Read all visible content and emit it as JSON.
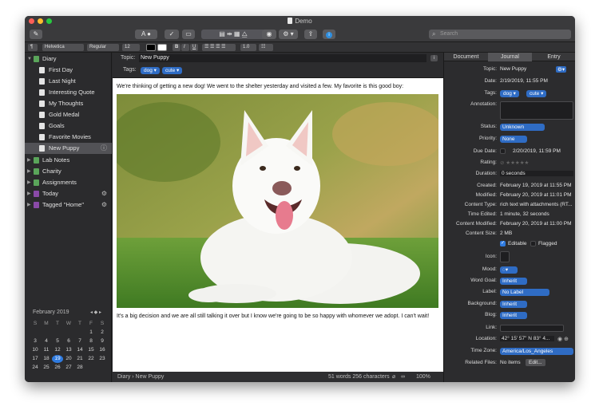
{
  "window": {
    "title": "Demo"
  },
  "toolbar": {
    "search_placeholder": "Search"
  },
  "format": {
    "font": "Helvetica",
    "style": "Regular",
    "size": "12",
    "spacing": "1.0",
    "bold": "B",
    "italic": "I",
    "underline": "U"
  },
  "sidebar": {
    "items": [
      {
        "label": "Diary",
        "color": "#5aa55a"
      },
      {
        "label": "First Day"
      },
      {
        "label": "Last Night"
      },
      {
        "label": "Interesting Quote"
      },
      {
        "label": "My Thoughts"
      },
      {
        "label": "Gold Medal"
      },
      {
        "label": "Goals"
      },
      {
        "label": "Favorite Movies"
      },
      {
        "label": "New Puppy"
      },
      {
        "label": "Lab Notes",
        "color": "#5aa55a"
      },
      {
        "label": "Charity",
        "color": "#5aa55a"
      },
      {
        "label": "Assignments",
        "color": "#5aa55a"
      },
      {
        "label": "Today",
        "color": "#8a4aa8"
      },
      {
        "label": "Tagged \"Home\"",
        "color": "#8a4aa8"
      }
    ]
  },
  "calendar": {
    "month": "February 2019",
    "weekdays": [
      "S",
      "M",
      "T",
      "W",
      "T",
      "F",
      "S"
    ],
    "weeks": [
      [
        "",
        "",
        "",
        "",
        "",
        "1",
        "2"
      ],
      [
        "3",
        "4",
        "5",
        "6",
        "7",
        "8",
        "9"
      ],
      [
        "10",
        "11",
        "12",
        "13",
        "14",
        "15",
        "16"
      ],
      [
        "17",
        "18",
        "19",
        "20",
        "21",
        "22",
        "23"
      ],
      [
        "24",
        "25",
        "26",
        "27",
        "28",
        "",
        ""
      ]
    ],
    "selected": "19"
  },
  "editor": {
    "topic_label": "Topic:",
    "topic": "New Puppy",
    "tags_label": "Tags:",
    "tags": [
      "dog",
      "cute"
    ],
    "paragraph1": "We're thinking of getting a new dog! We went to the shelter yesterday and visited a few. My favorite is this good boy:",
    "paragraph2": "It's a big decision and we are all still talking it over but I know we're going to be so happy with whomever we adopt. I can't wait!"
  },
  "status": {
    "breadcrumb": "Diary › New Puppy",
    "counts": "51 words 256 characters",
    "zoom": "100%"
  },
  "inspector": {
    "tabs": [
      "Document",
      "Journal",
      "Entry"
    ],
    "active_tab": "Journal",
    "topic": {
      "label": "Topic:",
      "value": "New Puppy"
    },
    "date": {
      "label": "Date:",
      "value": "2/19/2019, 11:55 PM"
    },
    "tags": {
      "label": "Tags:",
      "values": [
        "dog",
        "cute"
      ]
    },
    "annotation": {
      "label": "Annotation:"
    },
    "status": {
      "label": "Status:",
      "value": "Unknown"
    },
    "priority": {
      "label": "Priority:",
      "value": "None"
    },
    "due_date": {
      "label": "Due Date:",
      "value": "2/20/2019, 11:59 PM"
    },
    "rating": {
      "label": "Rating:",
      "value": 0,
      "max": 5
    },
    "duration": {
      "label": "Duration:",
      "value": "0 seconds"
    },
    "created": {
      "label": "Created:",
      "value": "February 19, 2019 at 11:55 PM"
    },
    "modified": {
      "label": "Modified:",
      "value": "February 20, 2019 at 11:01 PM"
    },
    "content_type": {
      "label": "Content Type:",
      "value": "rich text with attachments (RT..."
    },
    "time_edited": {
      "label": "Time Edited:",
      "value": "1 minute, 32 seconds"
    },
    "content_modified": {
      "label": "Content Modified:",
      "value": "February 20, 2019 at 11:00 PM"
    },
    "content_size": {
      "label": "Content Size:",
      "value": "2 MB"
    },
    "editable": {
      "label": "Editable",
      "checked": true
    },
    "flagged": {
      "label": "Flagged",
      "checked": false
    },
    "icon": {
      "label": "Icon:"
    },
    "mood": {
      "label": "Mood:"
    },
    "word_goal": {
      "label": "Word Goal:",
      "value": "Inherit"
    },
    "label": {
      "label": "Label:",
      "value": "No Label"
    },
    "background": {
      "label": "Background:",
      "value": "Inherit"
    },
    "blog": {
      "label": "Blog:",
      "value": "Inherit"
    },
    "link": {
      "label": "Link:"
    },
    "location": {
      "label": "Location:",
      "value": "42° 15' 57\" N 83° 4..."
    },
    "time_zone": {
      "label": "Time Zone:",
      "value": "America/Los_Angeles"
    },
    "related_files": {
      "label": "Related Files:",
      "value": "No items",
      "button": "Edit..."
    }
  },
  "colors": {
    "accent": "#2f6cc4",
    "selection": "#525256"
  }
}
